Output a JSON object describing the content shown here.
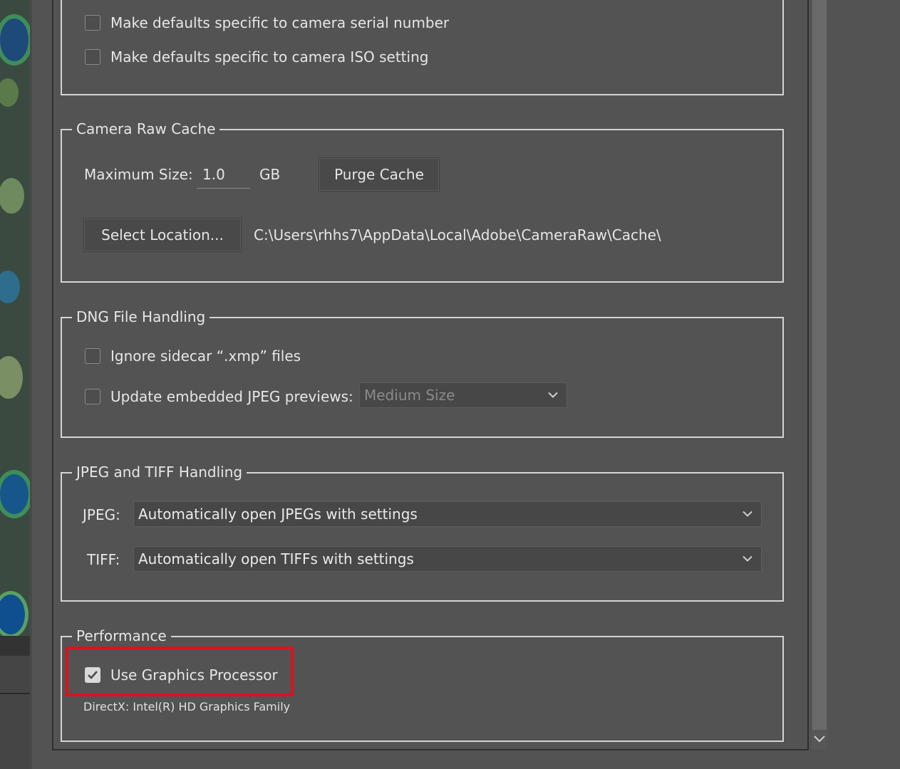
{
  "defaults_section": {
    "serial_label": "Make defaults specific to camera serial number",
    "iso_label": "Make defaults specific to camera ISO setting"
  },
  "cache": {
    "title": "Camera Raw Cache",
    "max_size_label": "Maximum Size:",
    "max_size_value": "1.0",
    "unit": "GB",
    "purge_button": "Purge Cache",
    "select_location_button": "Select Location...",
    "path": "C:\\Users\\rhhs7\\AppData\\Local\\Adobe\\CameraRaw\\Cache\\"
  },
  "dng": {
    "title": "DNG File Handling",
    "ignore_sidecar_label": "Ignore sidecar “.xmp” files",
    "update_previews_label": "Update embedded JPEG previews:",
    "preview_size_value": "Medium Size"
  },
  "jpeg_tiff": {
    "title": "JPEG and TIFF Handling",
    "jpeg_label": "JPEG:",
    "jpeg_value": "Automatically open JPEGs with settings",
    "tiff_label": "TIFF:",
    "tiff_value": "Automatically open TIFFs with settings"
  },
  "performance": {
    "title": "Performance",
    "gpu_label": "Use Graphics Processor",
    "gpu_checked": true,
    "gpu_info": "DirectX: Intel(R) HD Graphics Family"
  },
  "colors": {
    "highlight": "#e0101c",
    "panel_bg": "#535353"
  }
}
